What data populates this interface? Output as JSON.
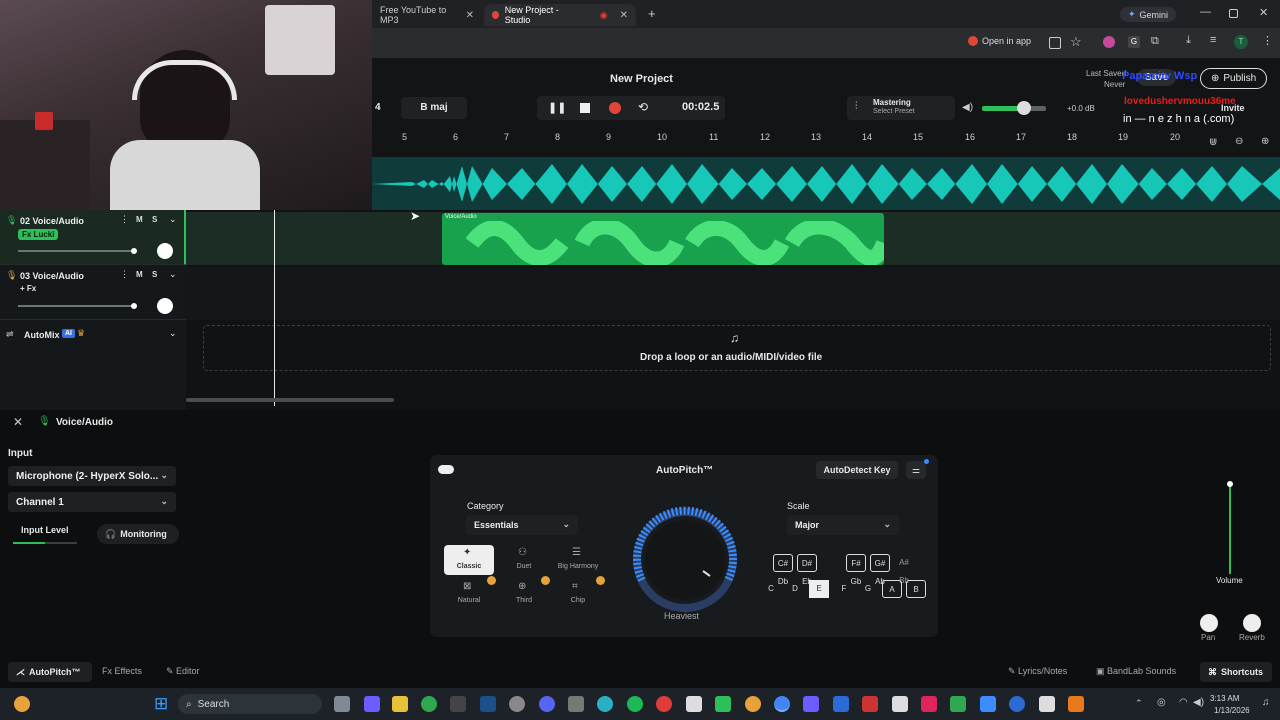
{
  "browser": {
    "tab1_title": "Free YouTube to MP3",
    "tab2_title": "New Project - Studio",
    "gemini": "Gemini",
    "open_in_app": "Open in app"
  },
  "header": {
    "project_title": "New Project",
    "last_saved_label": "Last Saved",
    "last_saved_value": "Never",
    "save_label": "Save",
    "publish_label": "Publish",
    "invite_label": "Invite",
    "beats": "4",
    "key": "B maj",
    "time": "00:02.5",
    "mastering_label": "Mastering",
    "mastering_sub": "Select Preset",
    "volume_db": "+0.0 dB"
  },
  "overlay": {
    "line1": "Papamitv Wsp",
    "line2": "lovedushervmouu36me",
    "line3": "in — n e z h n a (.com)"
  },
  "ruler": [
    "5",
    "6",
    "7",
    "8",
    "9",
    "10",
    "11",
    "12",
    "13",
    "14",
    "15",
    "16",
    "17",
    "18",
    "19",
    "20"
  ],
  "tracks": [
    {
      "name": "02 Voice/Audio",
      "fx": "Fx Lucki",
      "mute": "M",
      "solo": "S"
    },
    {
      "name": "03 Voice/Audio",
      "fx": "+ Fx",
      "mute": "M",
      "solo": "S"
    }
  ],
  "automix": {
    "label": "AutoMix",
    "ai": "AI"
  },
  "clip_label": "Voice/Audio",
  "dropzone_text": "Drop a loop or an audio/MIDI/video file",
  "panel": {
    "title": "Voice/Audio",
    "input_label": "Input",
    "input_device": "Microphone (2- HyperX Solo...",
    "channel": "Channel 1",
    "input_level_label": "Input Level",
    "monitoring_label": "Monitoring"
  },
  "autopitch": {
    "title": "AutoPitch™",
    "autodetect": "AutoDetect Key",
    "category_label": "Category",
    "category_value": "Essentials",
    "scale_label": "Scale",
    "scale_value": "Major",
    "knob_label": "Heaviest",
    "modes": [
      "Classic",
      "Duet",
      "Big Harmony",
      "Natural",
      "Third",
      "Chip"
    ],
    "accidentals": [
      "C# Db",
      "D# Eb",
      "F# Gb",
      "G# Ab",
      "A# Bb"
    ],
    "keys": [
      "C",
      "D",
      "E",
      "F",
      "G",
      "A",
      "B"
    ]
  },
  "right_controls": {
    "volume": "Volume",
    "pan": "Pan",
    "reverb": "Reverb",
    "pan_l": "L",
    "pan_r": "R"
  },
  "bottom_tabs": {
    "autopitch": "AutoPitch™",
    "effects": "Effects",
    "editor": "Editor",
    "lyrics": "Lyrics/Notes",
    "sounds": "BandLab Sounds",
    "shortcuts": "Shortcuts"
  },
  "taskbar": {
    "search": "Search",
    "time": "3:13 AM",
    "date": "1/13/2026"
  },
  "colors": {
    "accent_green": "#2fbf5a",
    "wave_teal": "#17c7b8",
    "record_red": "#e0453a"
  }
}
